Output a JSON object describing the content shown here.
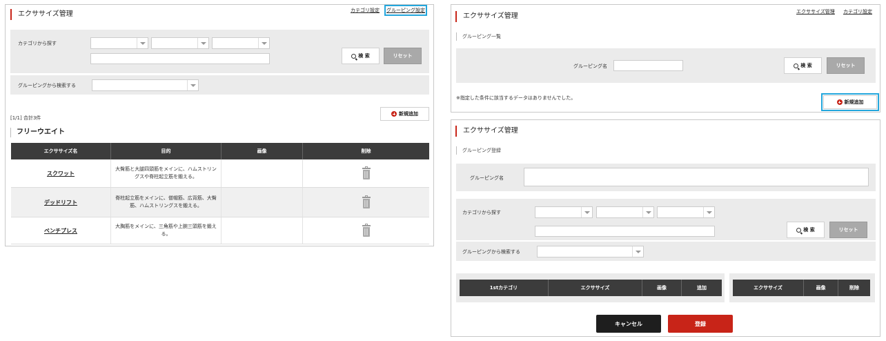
{
  "left": {
    "title": "エクササイズ管理",
    "link_category": "カテゴリ設定",
    "link_grouping": "グルーピング設定",
    "search_category_label": "カテゴリから探す",
    "search_button": "検 索",
    "reset_button": "リセット",
    "search_grouping_label": "グルーピングから検索する",
    "count_text": "[1/1] 合計3件",
    "add_button": "新規追加",
    "section_title": "フリーウエイト",
    "columns": [
      "エクササイズ名",
      "目的",
      "画像",
      "削除"
    ],
    "rows": [
      {
        "name": "スクワット",
        "purpose": "大臀筋と大腿四頭筋をメインに、ハムストリングスや脊柱起立筋を鍛える。"
      },
      {
        "name": "デッドリフト",
        "purpose": "脊柱起立筋をメインに、僧帽筋、広背筋、大臀筋、ハムストリングスを鍛える。"
      },
      {
        "name": "ベンチプレス",
        "purpose": "大胸筋をメインに、三角筋や上腕三頭筋を鍛える。"
      }
    ]
  },
  "right_top": {
    "title": "エクササイズ管理",
    "link_exercise": "エクササイズ管理",
    "link_category": "カテゴリ設定",
    "subtitle": "グルーピング一覧",
    "grouping_name_label": "グルーピング名",
    "search_button": "検 索",
    "reset_button": "リセット",
    "no_data_message": "※指定した条件に該当するデータはありませんでした。",
    "add_button": "新規追加"
  },
  "right_bottom": {
    "title": "エクササイズ管理",
    "subtitle": "グルーピング登録",
    "grouping_name_label": "グルーピング名",
    "search_category_label": "カテゴリから探す",
    "search_button": "検 索",
    "reset_button": "リセット",
    "search_grouping_label": "グルーピングから検索する",
    "left_columns": [
      "1stカテゴリ",
      "エクササイズ",
      "画像",
      "追加"
    ],
    "right_columns": [
      "エクササイズ",
      "画像",
      "削除"
    ],
    "cancel_button": "キャンセル",
    "register_button": "登録"
  },
  "colors": {
    "accent_red": "#c82418",
    "highlight_blue": "#23a6dc",
    "header_dark": "#3c3c3c"
  },
  "icons": [
    "search-icon",
    "plus-circle-icon",
    "trash-icon",
    "chevron-down-icon"
  ]
}
